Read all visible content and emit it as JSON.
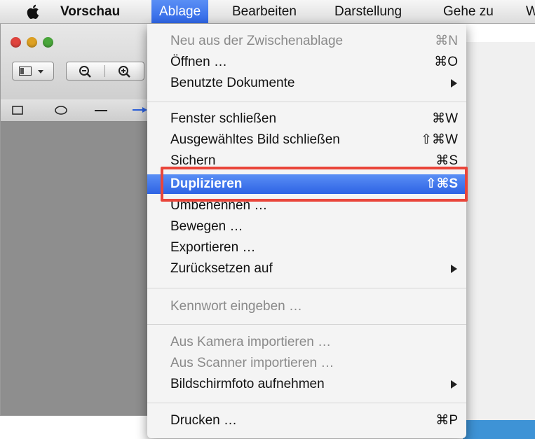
{
  "menubar": {
    "apple_icon": "apple-icon",
    "items": [
      {
        "label": "Vorschau",
        "bold": true
      },
      {
        "label": "Ablage",
        "active": true
      },
      {
        "label": "Bearbeiten"
      },
      {
        "label": "Darstellung"
      },
      {
        "label": "Gehe zu"
      },
      {
        "label": "W"
      }
    ]
  },
  "menu": {
    "items": [
      {
        "label": "Neu aus der Zwischenablage",
        "shortcut": "⌘N",
        "disabled": true
      },
      {
        "label": "Öffnen …",
        "shortcut": "⌘O"
      },
      {
        "label": "Benutzte Dokumente",
        "submenu": true
      },
      {
        "label": "Fenster schließen",
        "shortcut": "⌘W"
      },
      {
        "label": "Ausgewähltes Bild schließen",
        "shortcut": "⇧⌘W"
      },
      {
        "label": "Sichern",
        "shortcut": "⌘S"
      },
      {
        "label": "Duplizieren",
        "shortcut": "⇧⌘S",
        "highlighted": true
      },
      {
        "label": "Umbenennen …"
      },
      {
        "label": "Bewegen …"
      },
      {
        "label": "Exportieren …"
      },
      {
        "label": "Zurücksetzen auf",
        "submenu": true
      },
      {
        "label": "Kennwort eingeben …",
        "disabled": true
      },
      {
        "label": "Aus Kamera importieren …",
        "disabled": true
      },
      {
        "label": "Aus Scanner importieren …",
        "disabled": true
      },
      {
        "label": "Bildschirmfoto aufnehmen",
        "submenu": true
      },
      {
        "label": "Drucken …",
        "shortcut": "⌘P"
      }
    ]
  },
  "colors": {
    "highlight": "#3a73ea",
    "callout": "#e9453a"
  }
}
